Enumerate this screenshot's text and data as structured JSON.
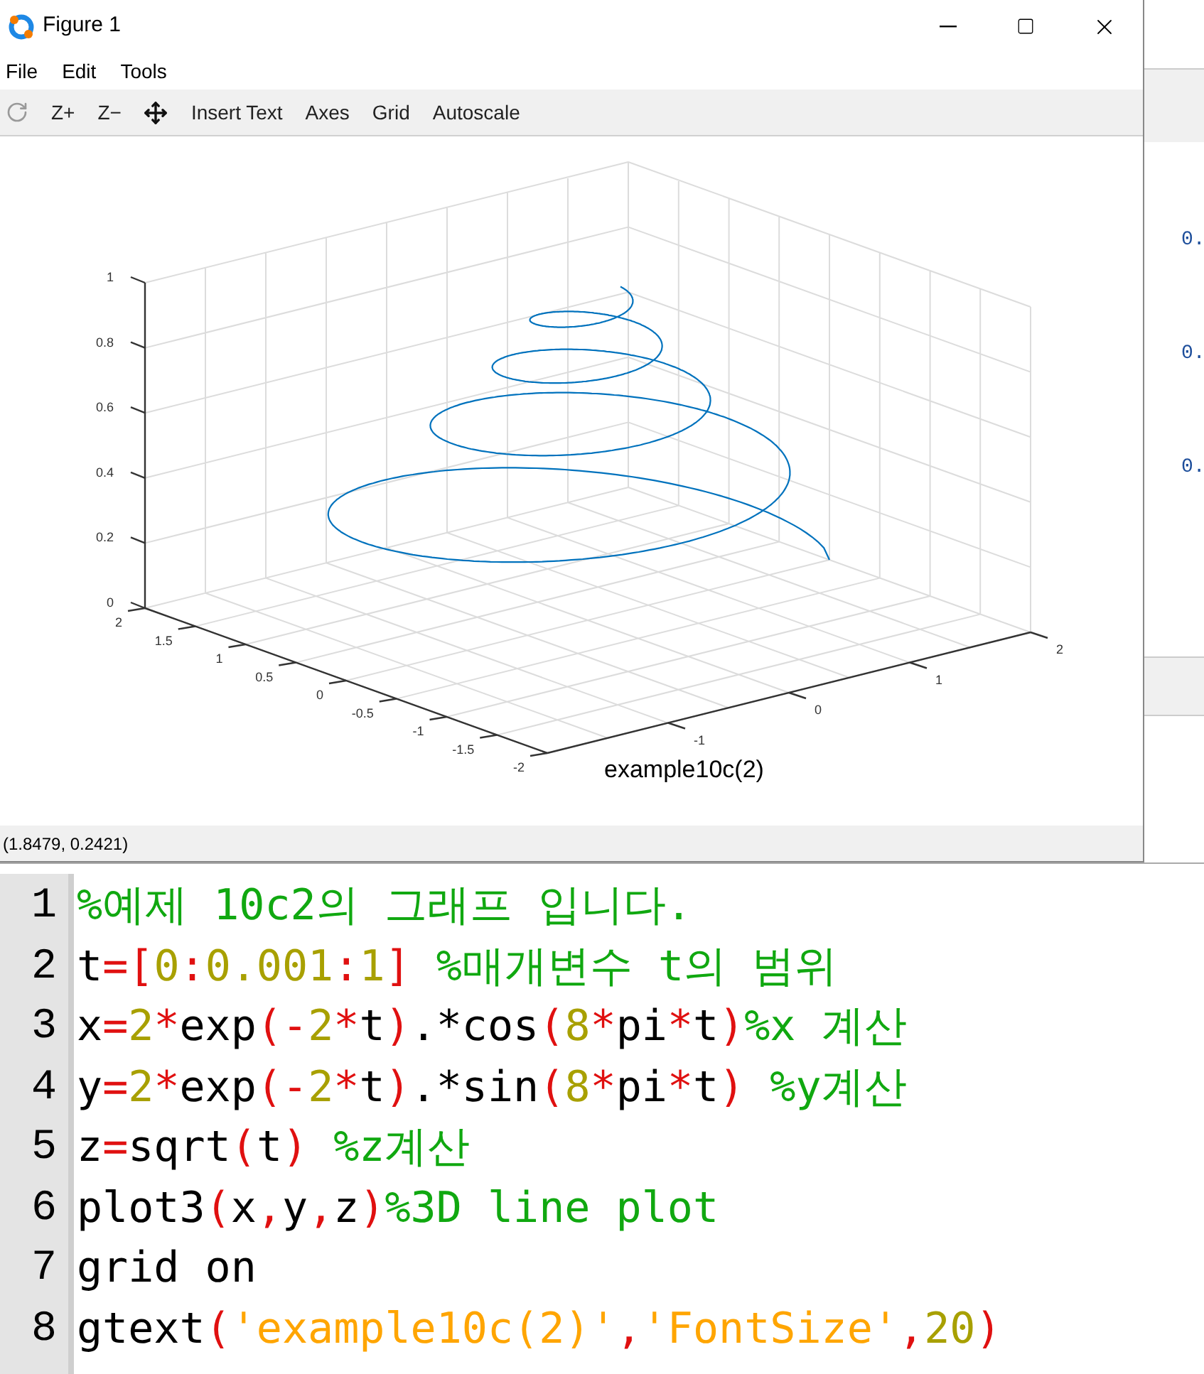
{
  "window": {
    "title": "Figure 1"
  },
  "menu": [
    "File",
    "Edit",
    "Tools"
  ],
  "toolbar": [
    "Z+",
    "Z−",
    "Insert Text",
    "Axes",
    "Grid",
    "Autoscale"
  ],
  "plot": {
    "z_ticks": [
      "1",
      "0.8",
      "0.6",
      "0.4",
      "0.2",
      "0"
    ],
    "y_ticks": [
      "2",
      "1.5",
      "1",
      "0.5",
      "0",
      "-0.5",
      "-1",
      "-1.5",
      "-2"
    ],
    "x_ticks": [
      "-1",
      "0",
      "1",
      "2"
    ],
    "annotation": "example10c(2)"
  },
  "status_bar": "(1.8479, 0.2421)",
  "background_values": [
    "0.",
    "0.",
    "0."
  ],
  "editor": {
    "lines": [
      {
        "number": "1",
        "tokens": [
          {
            "kind": "comment",
            "text": "%예제 10c2의 그래프 입니다."
          }
        ]
      },
      {
        "number": "2",
        "tokens": [
          {
            "kind": "plain",
            "text": "t"
          },
          {
            "kind": "op",
            "text": "=["
          },
          {
            "kind": "num",
            "text": "0"
          },
          {
            "kind": "op",
            "text": ":"
          },
          {
            "kind": "num",
            "text": "0.001"
          },
          {
            "kind": "op",
            "text": ":"
          },
          {
            "kind": "num",
            "text": "1"
          },
          {
            "kind": "op",
            "text": "]"
          },
          {
            "kind": "comment",
            "text": " %매개변수 t의 범위"
          }
        ]
      },
      {
        "number": "3",
        "tokens": [
          {
            "kind": "plain",
            "text": "x"
          },
          {
            "kind": "op",
            "text": "="
          },
          {
            "kind": "num",
            "text": "2"
          },
          {
            "kind": "op",
            "text": "*"
          },
          {
            "kind": "plain",
            "text": "exp"
          },
          {
            "kind": "op",
            "text": "(-"
          },
          {
            "kind": "num",
            "text": "2"
          },
          {
            "kind": "op",
            "text": "*"
          },
          {
            "kind": "plain",
            "text": "t"
          },
          {
            "kind": "op",
            "text": ")"
          },
          {
            "kind": "plain",
            "text": ".*cos"
          },
          {
            "kind": "op",
            "text": "("
          },
          {
            "kind": "num",
            "text": "8"
          },
          {
            "kind": "op",
            "text": "*"
          },
          {
            "kind": "plain",
            "text": "pi"
          },
          {
            "kind": "op",
            "text": "*"
          },
          {
            "kind": "plain",
            "text": "t"
          },
          {
            "kind": "op",
            "text": ")"
          },
          {
            "kind": "comment",
            "text": "%x 계산"
          }
        ]
      },
      {
        "number": "4",
        "tokens": [
          {
            "kind": "plain",
            "text": "y"
          },
          {
            "kind": "op",
            "text": "="
          },
          {
            "kind": "num",
            "text": "2"
          },
          {
            "kind": "op",
            "text": "*"
          },
          {
            "kind": "plain",
            "text": "exp"
          },
          {
            "kind": "op",
            "text": "(-"
          },
          {
            "kind": "num",
            "text": "2"
          },
          {
            "kind": "op",
            "text": "*"
          },
          {
            "kind": "plain",
            "text": "t"
          },
          {
            "kind": "op",
            "text": ")"
          },
          {
            "kind": "plain",
            "text": ".*sin"
          },
          {
            "kind": "op",
            "text": "("
          },
          {
            "kind": "num",
            "text": "8"
          },
          {
            "kind": "op",
            "text": "*"
          },
          {
            "kind": "plain",
            "text": "pi"
          },
          {
            "kind": "op",
            "text": "*"
          },
          {
            "kind": "plain",
            "text": "t"
          },
          {
            "kind": "op",
            "text": ")"
          },
          {
            "kind": "comment",
            "text": " %y계산"
          }
        ]
      },
      {
        "number": "5",
        "tokens": [
          {
            "kind": "plain",
            "text": "z"
          },
          {
            "kind": "op",
            "text": "="
          },
          {
            "kind": "plain",
            "text": "sqrt"
          },
          {
            "kind": "op",
            "text": "("
          },
          {
            "kind": "plain",
            "text": "t"
          },
          {
            "kind": "op",
            "text": ")"
          },
          {
            "kind": "comment",
            "text": " %z계산"
          }
        ]
      },
      {
        "number": "6",
        "tokens": [
          {
            "kind": "plain",
            "text": "plot3"
          },
          {
            "kind": "op",
            "text": "("
          },
          {
            "kind": "plain",
            "text": "x"
          },
          {
            "kind": "op",
            "text": ","
          },
          {
            "kind": "plain",
            "text": "y"
          },
          {
            "kind": "op",
            "text": ","
          },
          {
            "kind": "plain",
            "text": "z"
          },
          {
            "kind": "op",
            "text": ")"
          },
          {
            "kind": "comment",
            "text": "%3D line plot"
          }
        ]
      },
      {
        "number": "7",
        "tokens": [
          {
            "kind": "plain",
            "text": "grid on"
          }
        ]
      },
      {
        "number": "8",
        "tokens": [
          {
            "kind": "plain",
            "text": "gtext"
          },
          {
            "kind": "op",
            "text": "("
          },
          {
            "kind": "str",
            "text": "'example10c(2)'"
          },
          {
            "kind": "op",
            "text": ","
          },
          {
            "kind": "str",
            "text": "'FontSize'"
          },
          {
            "kind": "op",
            "text": ","
          },
          {
            "kind": "num",
            "text": "20"
          },
          {
            "kind": "op",
            "text": ")"
          }
        ]
      }
    ]
  }
}
